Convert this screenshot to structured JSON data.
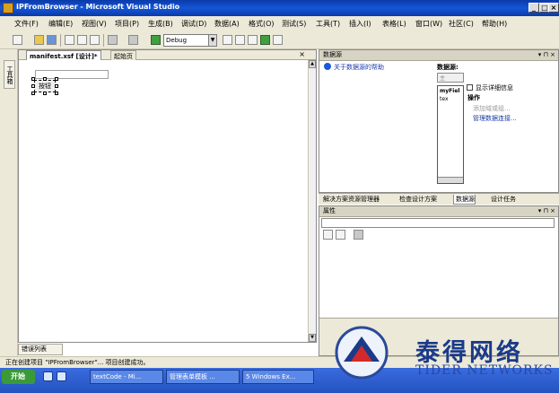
{
  "window": {
    "title": "IPFromBrowser - Microsoft Visual Studio"
  },
  "menu": [
    "文件(F)",
    "编辑(E)",
    "视图(V)",
    "项目(P)",
    "生成(B)",
    "调试(D)",
    "数据(A)",
    "格式(O)",
    "测试(S)",
    "工具(T)",
    "插入(I)",
    "表格(L)",
    "窗口(W)",
    "社区(C)",
    "帮助(H)"
  ],
  "toolbar": {
    "config": "Debug"
  },
  "left_strip": {
    "toolbox": "工具箱"
  },
  "editor": {
    "tabs": [
      "manifest.xsf [设计]*",
      "起始页"
    ],
    "button_label": "按钮"
  },
  "datasource": {
    "header": "数据源",
    "help": "关于数据源的帮助",
    "label": "数据源:",
    "combo": "主",
    "tree_root": "myFiel",
    "tree_child": "tex",
    "checkbox": "显示详细信息",
    "ops_title": "操作",
    "ops": [
      "添加域或组...",
      "管理数据连接..."
    ]
  },
  "subtabs": [
    "解决方案资源管理器",
    "检查设计方案",
    "数据源",
    "设计任务"
  ],
  "properties": {
    "header": "属性"
  },
  "errorlist": "错误列表",
  "status": "正在创建项目 \"IPFromBrowser\"... 项目创建成功。",
  "taskbar": {
    "start": "开始",
    "tasks": [
      "textCode - Mi...",
      "管理表单模板 ...",
      "5 Windows Ex..."
    ]
  },
  "watermark": {
    "cn": "泰得网络",
    "en": "TIDER NETWORKS"
  }
}
